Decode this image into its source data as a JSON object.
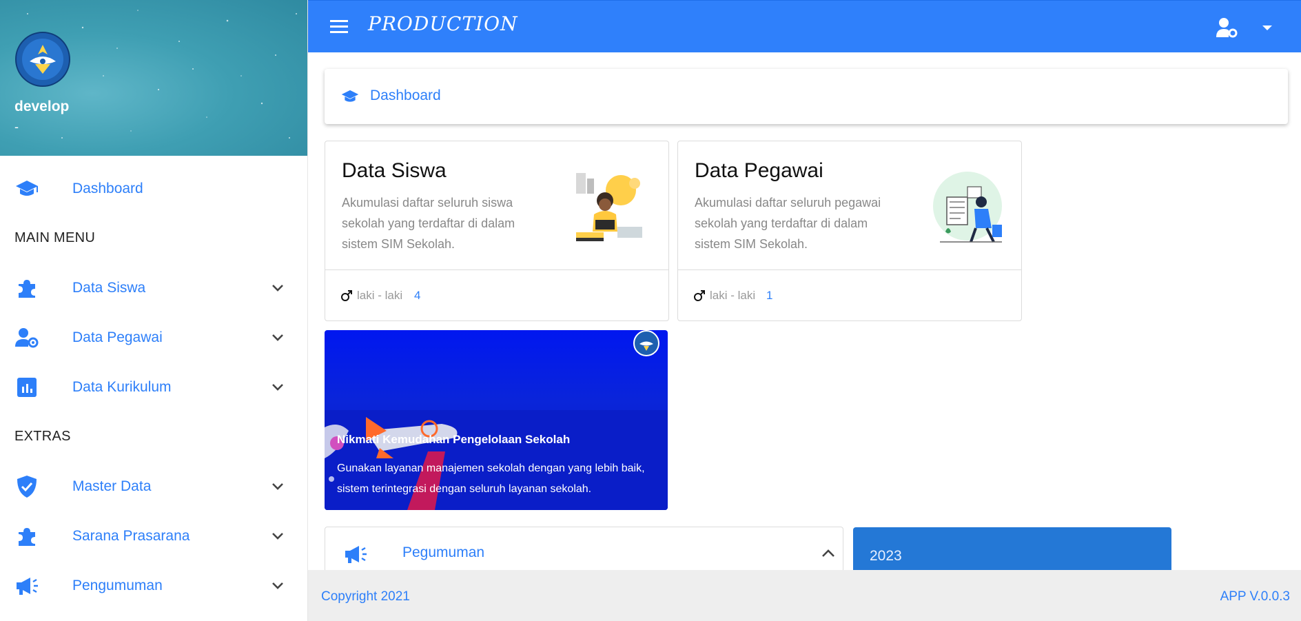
{
  "sidebar": {
    "profile_name": "develop",
    "profile_sub": "-",
    "items": [
      {
        "label": "Dashboard",
        "icon": "graduation-cap-icon"
      },
      {
        "label": "Data Siswa",
        "icon": "puzzle-icon"
      },
      {
        "label": "Data Pegawai",
        "icon": "user-gear-icon"
      },
      {
        "label": "Data Kurikulum",
        "icon": "chart-square-icon"
      },
      {
        "label": "Master Data",
        "icon": "shield-check-icon"
      },
      {
        "label": "Sarana Prasarana",
        "icon": "puzzle-icon"
      },
      {
        "label": "Pengumuman",
        "icon": "megaphone-icon"
      }
    ],
    "sections": {
      "main": "MAIN MENU",
      "extras": "EXTRAS"
    }
  },
  "topbar": {
    "brand": "PRODUCTION"
  },
  "breadcrumb": {
    "label": "Dashboard"
  },
  "cards": [
    {
      "title": "Data Siswa",
      "description": "Akumulasi daftar seluruh siswa sekolah yang terdaftar di dalam sistem SIM Sekolah.",
      "gender_label": "laki - laki",
      "count": "4"
    },
    {
      "title": "Data Pegawai",
      "description": "Akumulasi daftar seluruh pegawai sekolah yang terdaftar di dalam sistem SIM Sekolah.",
      "gender_label": "laki - laki",
      "count": "1"
    }
  ],
  "promo": {
    "title": "Nikmati Kemudahan Pengelolaan Sekolah",
    "text": "Gunakan layanan manajemen sekolah dengan yang lebih baik, sistem terintegrasi dengan seluruh layanan sekolah."
  },
  "announcement": {
    "label": "Pegumuman"
  },
  "year": "2023",
  "footer": {
    "copyright": "Copyright 2021",
    "version": "APP V.0.0.3"
  },
  "colors": {
    "accent": "#2d7ff9",
    "topbar": "#2f80fb",
    "year_card": "#2478d6",
    "promo": "#0017f0"
  }
}
